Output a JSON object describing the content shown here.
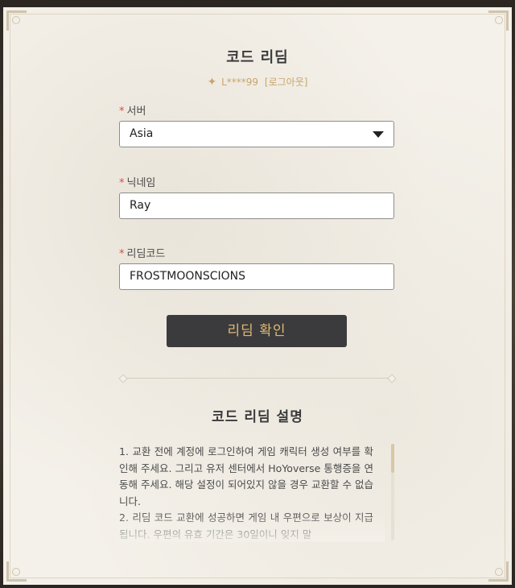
{
  "page": {
    "title": "코드 리딤",
    "account": {
      "star_icon": "sparkle-icon",
      "user": "L****99",
      "logout_label": "[로그아웃]"
    }
  },
  "form": {
    "server": {
      "label": "서버",
      "required_mark": "*",
      "value": "Asia"
    },
    "nickname": {
      "label": "닉네임",
      "required_mark": "*",
      "value": "Ray"
    },
    "code": {
      "label": "리딤코드",
      "required_mark": "*",
      "value": "FROSTMOONSCIONS"
    },
    "submit_label": "리딤 확인"
  },
  "description": {
    "title": "코드 리딤 설명",
    "items": [
      "1. 교환 전에 계정에 로그인하여 게임 캐릭터 생성 여부를 확인해 주세요. 그리고 유저 센터에서 HoYoverse 통행증을 연동해 주세요. 해당 설정이 되어있지 않을 경우 교환할 수 없습니다.",
      "2. 리딤 코드 교환에 성공하면 게임 내 우편으로 보상이 지급됩니다. 우편의 유효 기간은 30일이니 잊지 말"
    ]
  },
  "colors": {
    "accent_gold": "#e0b873",
    "required_red": "#d94b3f",
    "button_bg": "#3b3b3d",
    "panel_bg": "#f4f1ea"
  }
}
